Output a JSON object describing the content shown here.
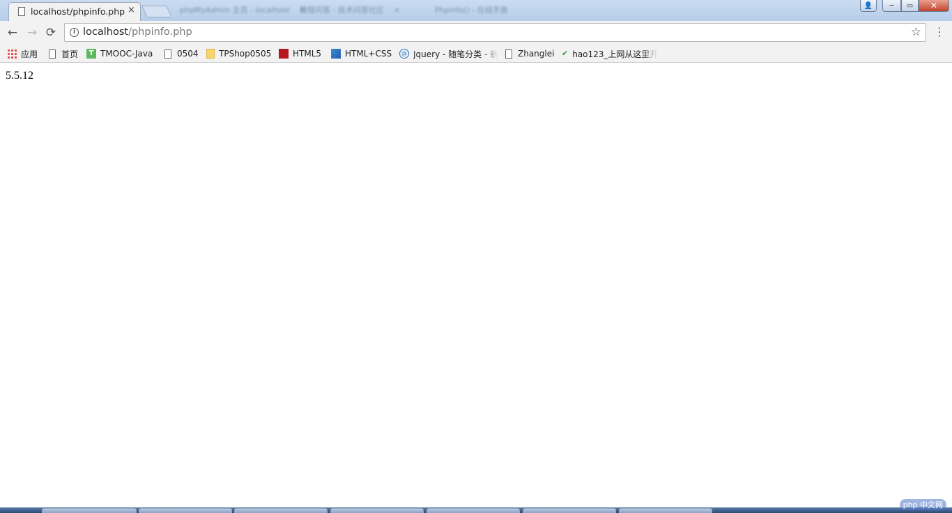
{
  "browser": {
    "active_tab": {
      "title": "localhost/phpinfo.php",
      "close": "×"
    },
    "blurred_tabs": [
      {
        "title": "phpMyAdmin 主页 - localhost"
      },
      {
        "title": "教程问答 - 技术问答社区"
      },
      {
        "title": "Phpinfo() - 在线手册"
      }
    ],
    "window_buttons": {
      "minimize": "─",
      "maximize": "▭",
      "close": "✕"
    },
    "nav": {
      "back": "←",
      "forward": "→",
      "reload": "⟳"
    },
    "address": {
      "host": "localhost",
      "path": "/phpinfo.php"
    },
    "star": "☆",
    "menu": "⋮"
  },
  "bookmarks": [
    {
      "label": "应用",
      "icon": "apps-grid-icon"
    },
    {
      "label": "首页",
      "icon": "page-icon"
    },
    {
      "label": "TMOOC-Java",
      "icon": "tmooc-icon"
    },
    {
      "label": "0504",
      "icon": "page-icon"
    },
    {
      "label": "TPShop0505",
      "icon": "folder-icon"
    },
    {
      "label": "HTML5",
      "icon": "red-logo-icon"
    },
    {
      "label": "HTML+CSS",
      "icon": "blue-logo-icon"
    },
    {
      "label": "Jquery - 随笔分类 - 新",
      "icon": "circle-logo-icon"
    },
    {
      "label": "Zhanglei",
      "icon": "page-icon"
    },
    {
      "label": "hao123_上网从这里开",
      "icon": "hao123-icon"
    }
  ],
  "page": {
    "text": "5.5.12"
  },
  "watermark": "php 中文网"
}
